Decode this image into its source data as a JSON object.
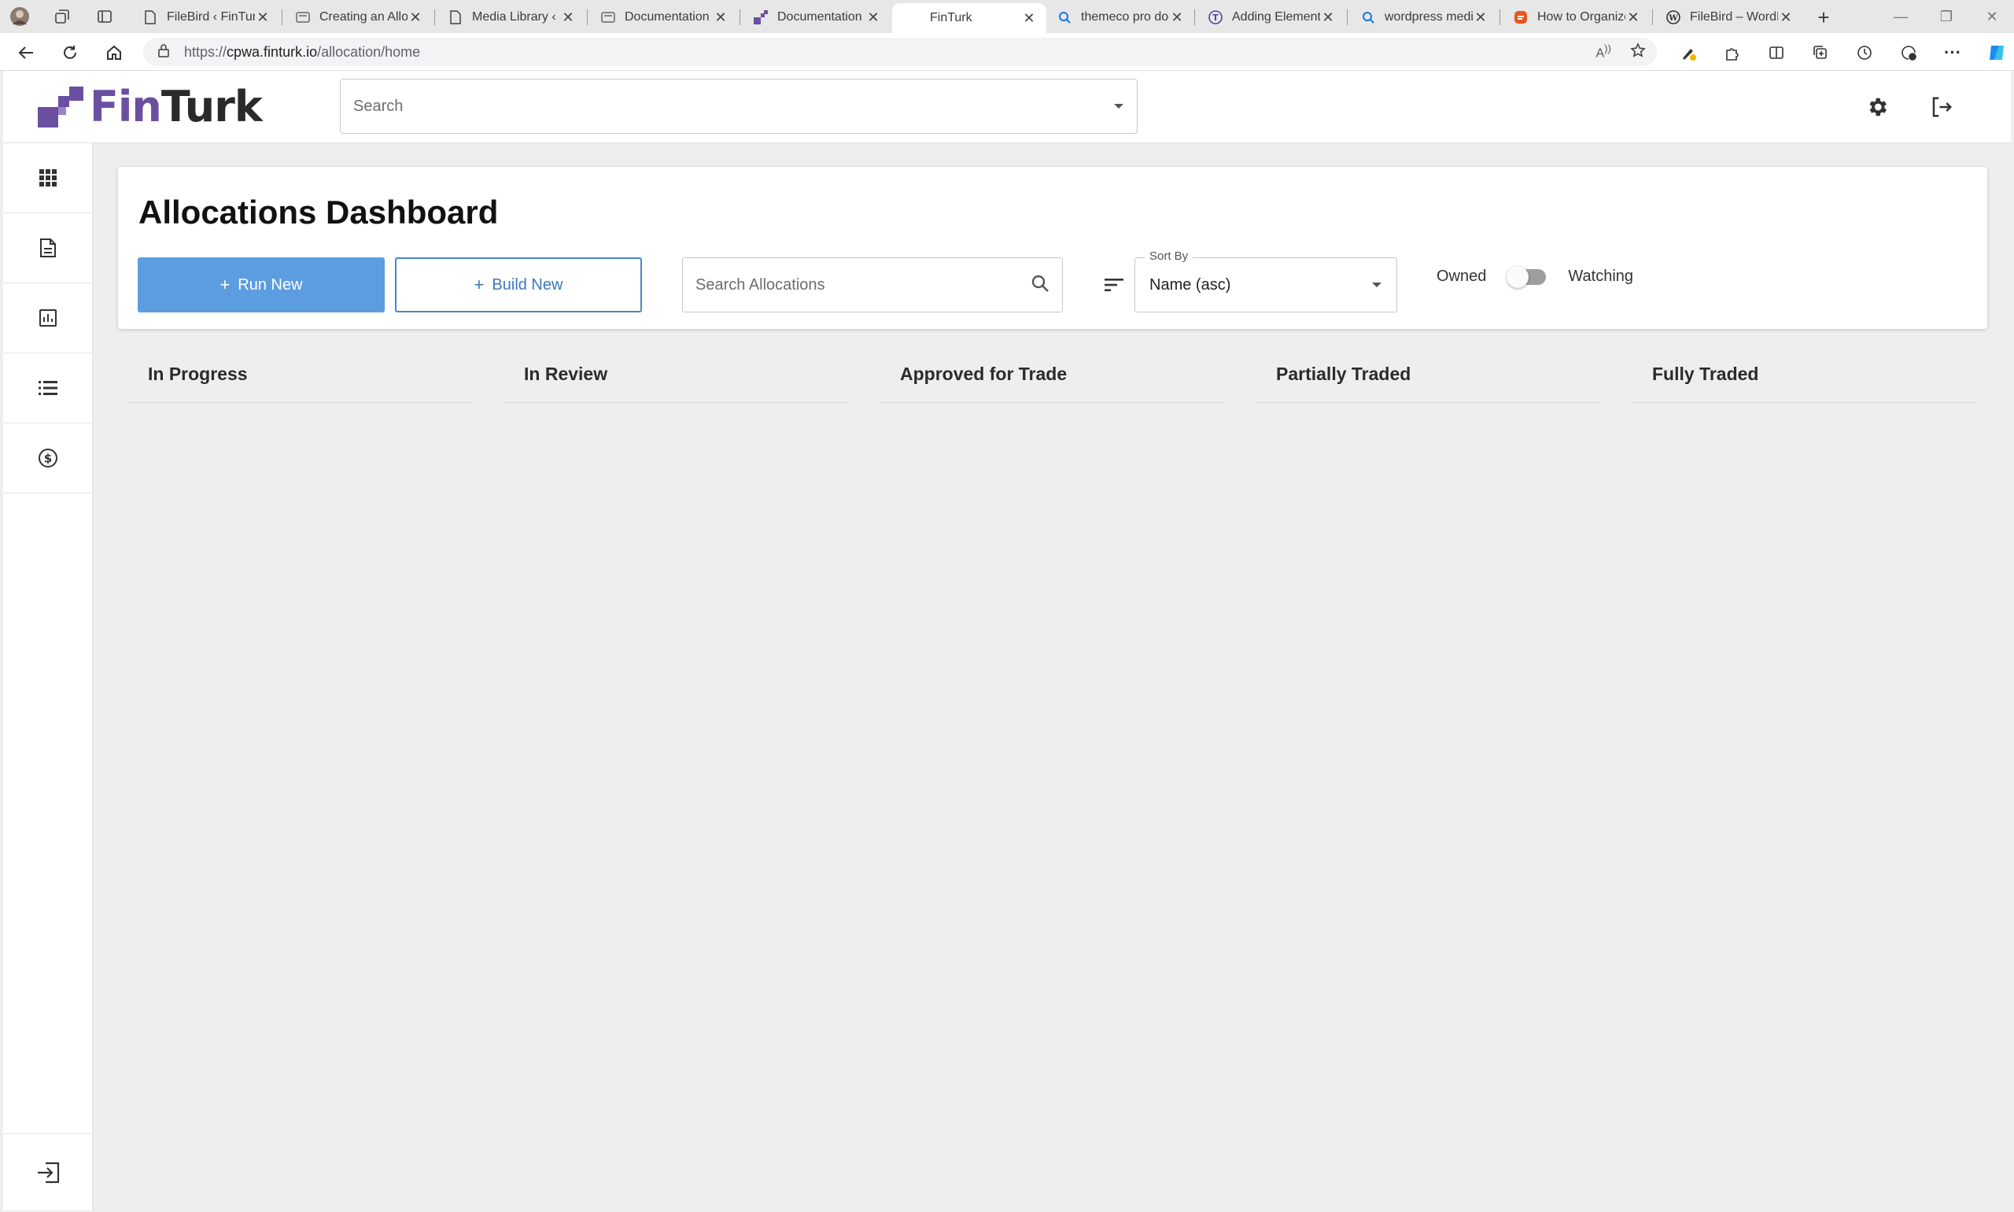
{
  "browser": {
    "tabs": [
      {
        "title": "FileBird ‹ FinTurk",
        "icon": "page-icon"
      },
      {
        "title": "Creating an Alloc",
        "icon": "doc-icon"
      },
      {
        "title": "Media Library ‹ F",
        "icon": "page-icon"
      },
      {
        "title": "Documentation -",
        "icon": "doc-icon"
      },
      {
        "title": "Documentation |",
        "icon": "finturk-icon"
      },
      {
        "title": "FinTurk",
        "icon": "none",
        "active": true
      },
      {
        "title": "themeco pro doc",
        "icon": "search-icon"
      },
      {
        "title": "Adding Element",
        "icon": "t-icon"
      },
      {
        "title": "wordpress media",
        "icon": "search-icon"
      },
      {
        "title": "How to Organize",
        "icon": "orange-icon"
      },
      {
        "title": "FileBird – WordP",
        "icon": "wordpress-icon"
      }
    ],
    "url_prefix": "https://",
    "url_host": "cpwa.finturk.io",
    "url_path": "/allocation/home"
  },
  "header": {
    "logo_fin": "Fin",
    "logo_turk": "Turk",
    "search_placeholder": "Search"
  },
  "dashboard": {
    "title": "Allocations Dashboard",
    "run_new_label": "Run New",
    "build_new_label": "Build New",
    "search_placeholder": "Search Allocations",
    "sort_label": "Sort By",
    "sort_value": "Name (asc)",
    "toggle_left": "Owned",
    "toggle_right": "Watching"
  },
  "columns": [
    "In Progress",
    "In Review",
    "Approved for Trade",
    "Partially Traded",
    "Fully Traded"
  ],
  "colors": {
    "brand_purple": "#6b4fa0",
    "primary_blue": "#5c9de0",
    "outline_blue": "#4a86c8"
  }
}
